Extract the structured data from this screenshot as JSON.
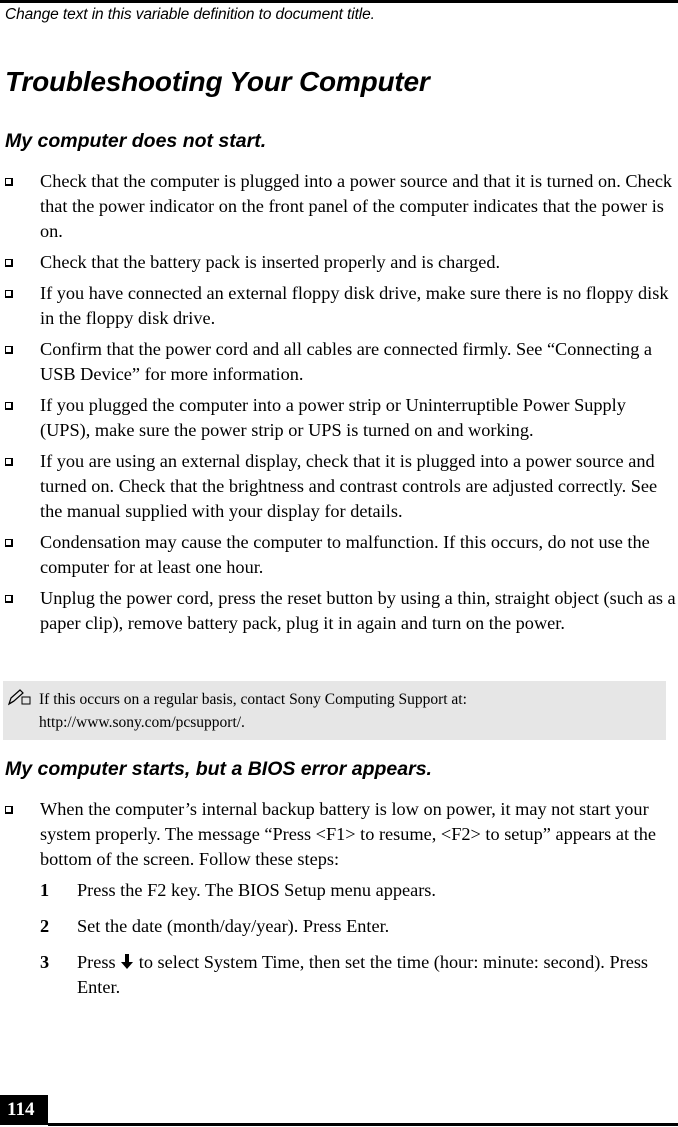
{
  "running_head": "Change text in this variable definition to document title.",
  "page_title": "Troubleshooting Your Computer",
  "sections": [
    {
      "heading": "My computer does not start.",
      "bullets": [
        "Check that the computer is plugged into a power source and that it is turned on. Check that the power indicator on the front panel of the computer indicates that the power is on.",
        "Check that the battery pack is inserted properly and is charged.",
        "If you have connected an external floppy disk drive, make sure there is no floppy disk in the floppy disk drive.",
        "Confirm that the power cord and all cables are connected firmly. See “Connecting a USB Device” for more information.",
        "If you plugged the computer into a power strip or Uninterruptible Power Supply (UPS), make sure the power strip or UPS is turned on and working.",
        "If you are using an external display, check that it is plugged into a power source and turned on. Check that the brightness and contrast controls are adjusted correctly. See the manual supplied with your display for details.",
        "Condensation may cause the computer to malfunction. If this occurs, do not use the computer for at least one hour.",
        "Unplug the power cord, press the reset button by using a thin, straight object (such as a paper clip), remove battery pack, plug it in again and turn on the power."
      ],
      "note": {
        "icon": "pencil-note-icon",
        "text": "If this occurs on a regular basis, contact Sony Computing Support at: http://www.sony.com/pcsupport/."
      }
    },
    {
      "heading": "My computer starts, but a BIOS error appears.",
      "bullets": [
        "When the computer’s internal backup battery is low on power, it may not start your system properly. The message “Press <F1> to resume, <F2> to setup” appears at the bottom of the screen. Follow these steps:"
      ],
      "steps": [
        {
          "num": "1",
          "text": "Press the F2 key. The BIOS Setup menu appears."
        },
        {
          "num": "2",
          "text": "Set the date (month/day/year). Press Enter."
        },
        {
          "num": "3",
          "text_before": "Press",
          "icon": "down-arrow-icon",
          "text_after": "to select System Time, then set the time (hour: minute: second). Press Enter."
        }
      ]
    }
  ],
  "page_number": "114"
}
